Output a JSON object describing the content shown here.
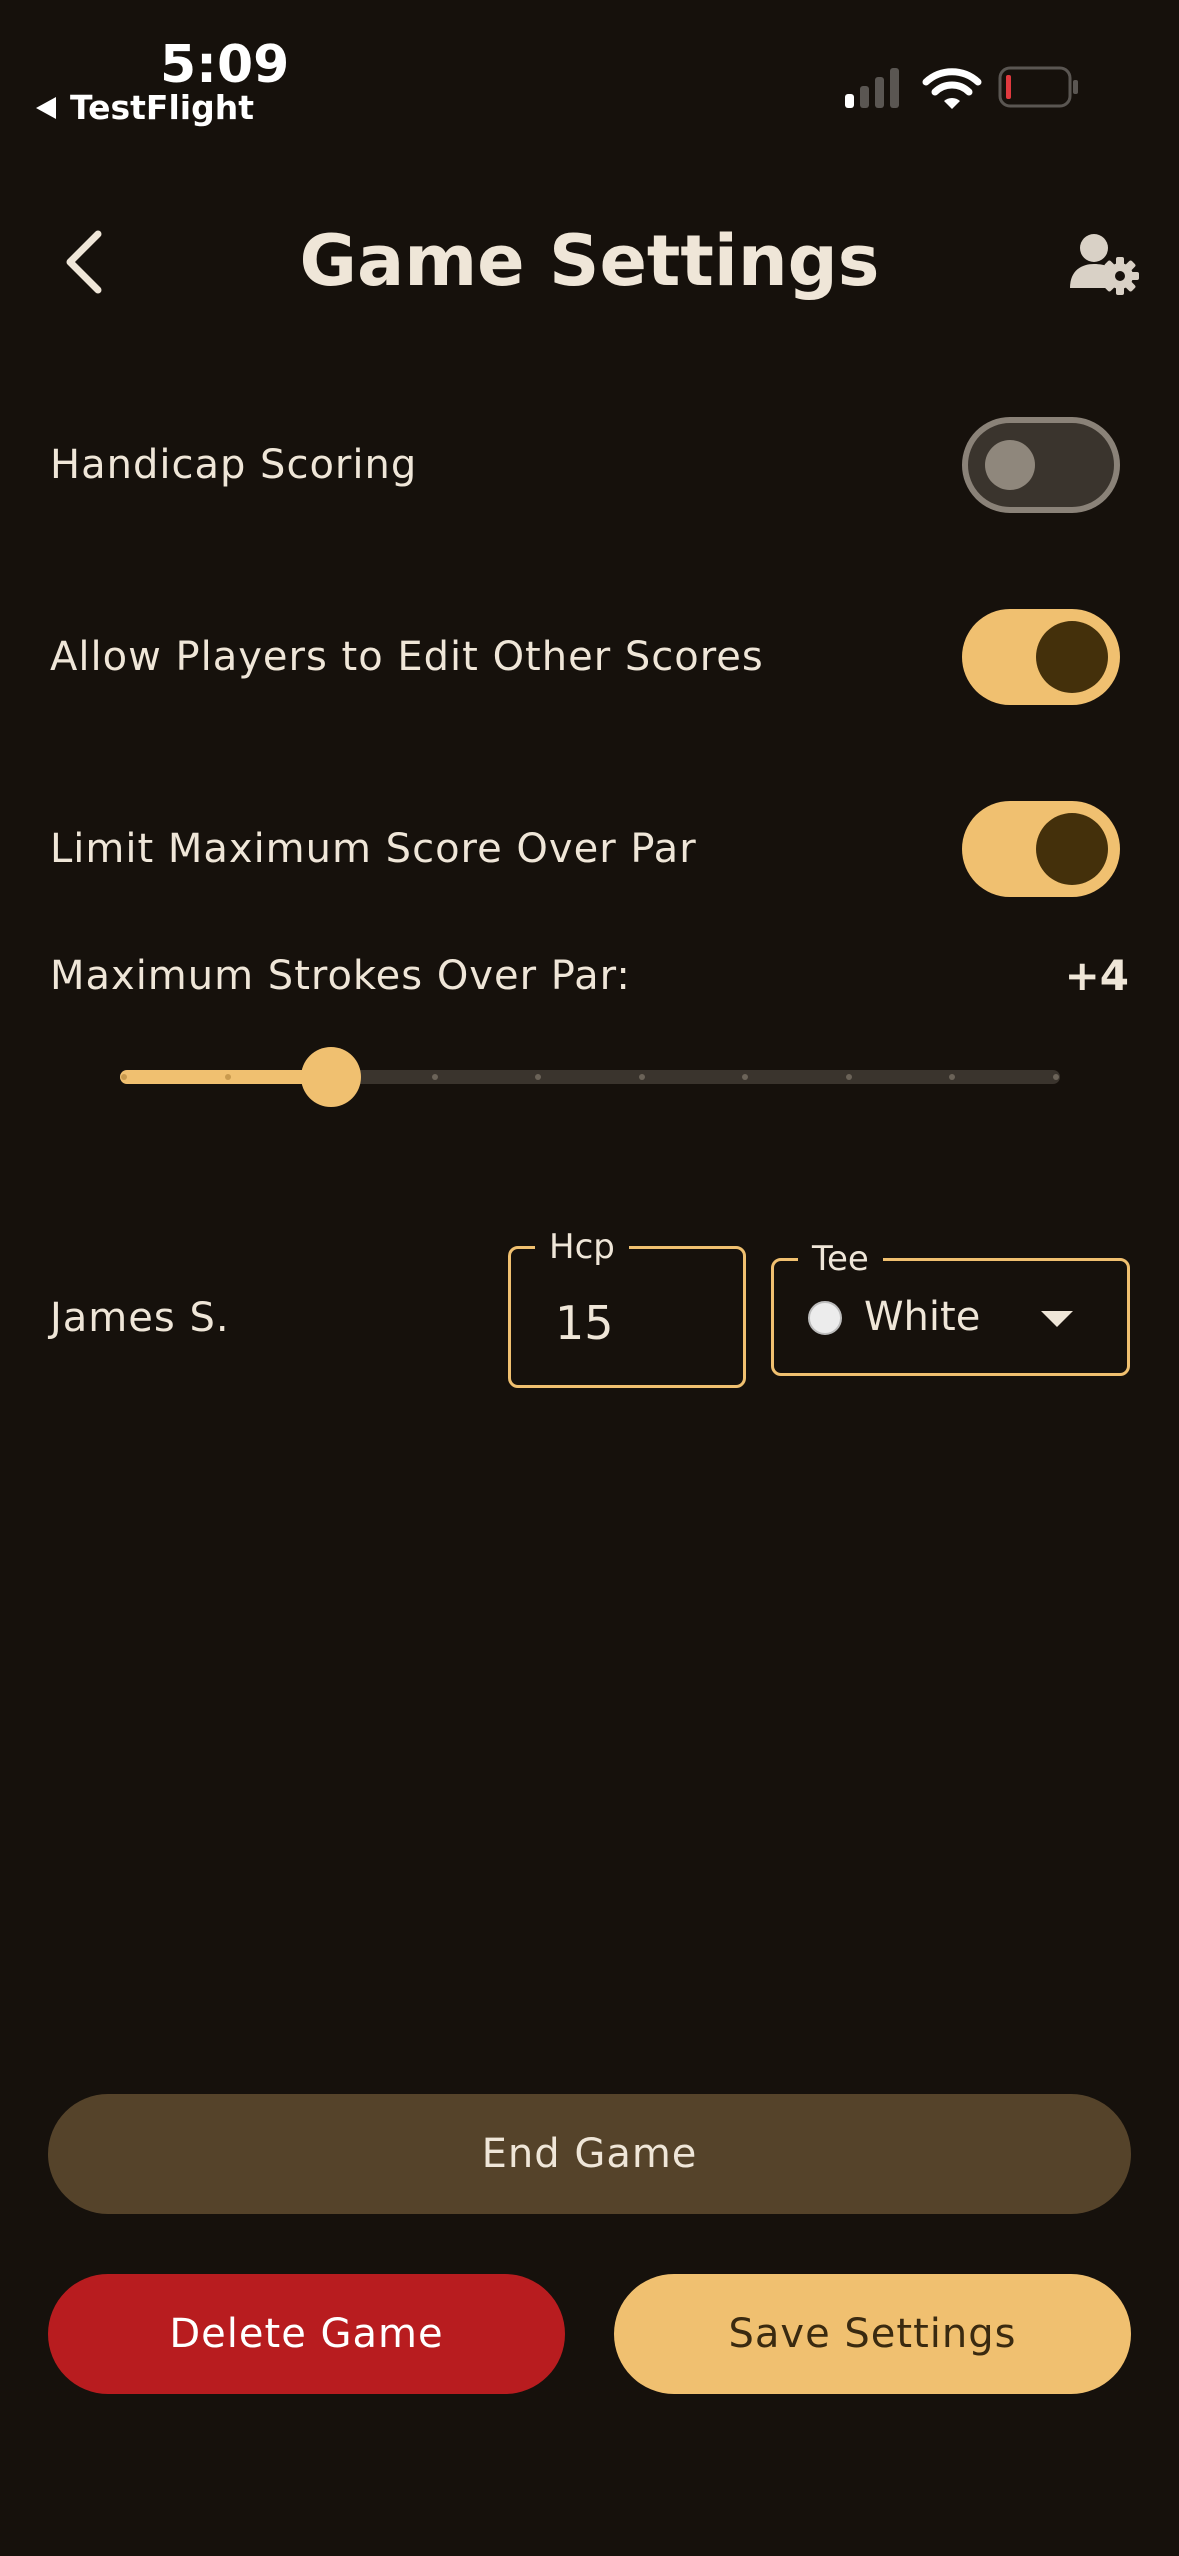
{
  "status_bar": {
    "time": "5:09",
    "back_app": "TestFlight",
    "battery_color": "#e0393e"
  },
  "header": {
    "title": "Game Settings",
    "back_icon": "chevron-left-icon",
    "user_settings_icon": "user-gear-icon"
  },
  "settings": {
    "handicap_scoring": {
      "label": "Handicap Scoring",
      "enabled": false
    },
    "allow_edit": {
      "label": "Allow Players to Edit Other Scores",
      "enabled": true
    },
    "limit_max": {
      "label": "Limit Maximum Score Over Par",
      "enabled": true
    },
    "max_strokes": {
      "label": "Maximum Strokes Over Par:",
      "value_display": "+4",
      "value": 4,
      "min": 2,
      "max": 11
    }
  },
  "player": {
    "name": "James S.",
    "hcp_label": "Hcp",
    "hcp_value": "15",
    "tee_label": "Tee",
    "tee_value": "White",
    "tee_color": "#ececec"
  },
  "buttons": {
    "end_game": "End Game",
    "delete_game": "Delete Game",
    "save_settings": "Save Settings"
  },
  "colors": {
    "background": "#16110c",
    "accent": "#f0c070",
    "danger": "#b81c1f",
    "muted_button": "#55432a"
  }
}
